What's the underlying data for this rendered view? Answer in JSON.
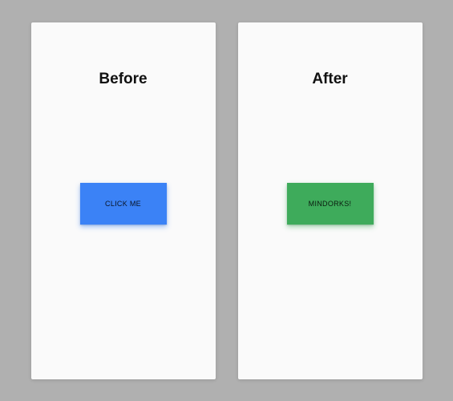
{
  "panels": {
    "before": {
      "title": "Before",
      "button_label": "CLICK ME",
      "button_color": "#3b82f6"
    },
    "after": {
      "title": "After",
      "button_label": "MINDORKS!",
      "button_color": "#3eab5b"
    }
  }
}
